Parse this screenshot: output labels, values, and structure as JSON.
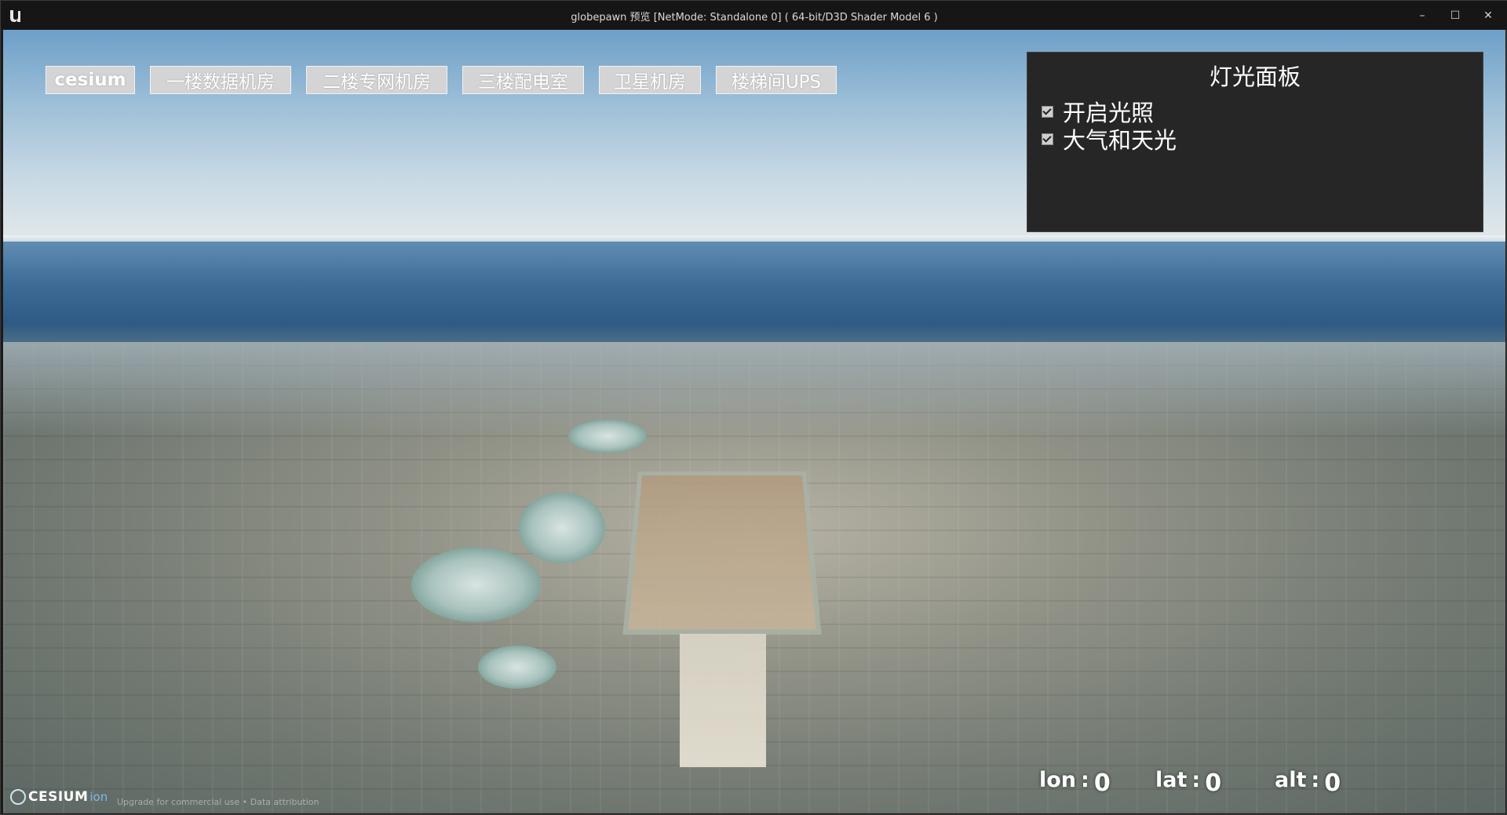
{
  "window": {
    "title": "globepawn 预览 [NetMode: Standalone 0]  ( 64-bit/D3D Shader Model 6 )",
    "app_icon": "unreal-engine-icon",
    "controls": {
      "minimize": "–",
      "maximize": "☐",
      "close": "✕"
    }
  },
  "nav": {
    "buttons": [
      {
        "label": "cesium"
      },
      {
        "label": "一楼数据机房"
      },
      {
        "label": "二楼专网机房"
      },
      {
        "label": "三楼配电室"
      },
      {
        "label": "卫星机房"
      },
      {
        "label": "楼梯间UPS"
      }
    ]
  },
  "light_panel": {
    "title": "灯光面板",
    "options": [
      {
        "label": "开启光照",
        "checked": true
      },
      {
        "label": "大气和天光",
        "checked": true
      }
    ]
  },
  "coordinates": {
    "lon": {
      "label": "lon",
      "value": "0"
    },
    "lat": {
      "label": "lat",
      "value": "0"
    },
    "alt": {
      "label": "alt",
      "value": "0"
    }
  },
  "attribution": {
    "logo_text": "CESIUM",
    "logo_suffix": "ion",
    "links": "Upgrade for commercial use  •  Data attribution"
  },
  "colors": {
    "button_bg": "#d4d4d4",
    "panel_bg": "#262626",
    "titlebar_bg": "#161616"
  }
}
